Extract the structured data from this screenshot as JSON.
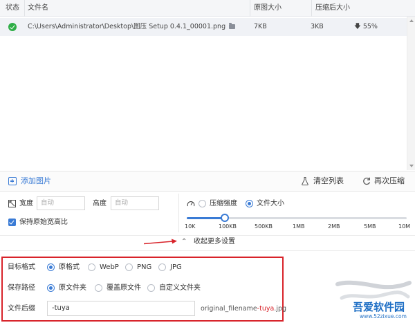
{
  "table": {
    "headers": {
      "status": "状态",
      "filename": "文件名",
      "original_size": "原图大小",
      "compressed_size": "压缩后大小"
    },
    "rows": [
      {
        "path": "C:\\Users\\Administrator\\Desktop\\图压 Setup 0.4.1_00001.png",
        "original": "7KB",
        "compressed": "3KB",
        "ratio": "55%"
      }
    ]
  },
  "toolbar": {
    "add_label": "添加图片",
    "clear_label": "清空列表",
    "recompress_label": "再次压缩"
  },
  "size": {
    "width_label": "宽度",
    "width_placeholder": "自动",
    "height_label": "高度",
    "height_placeholder": "自动",
    "keep_ratio_label": "保持原始宽高比"
  },
  "compress": {
    "strength_label": "压缩强度",
    "filesize_label": "文件大小",
    "ticks": [
      "10K",
      "100KB",
      "500KB",
      "1MB",
      "2MB",
      "5MB",
      "10M"
    ],
    "slider_value": "100KB"
  },
  "collapse_label": "收起更多设置",
  "settings": {
    "format_label": "目标格式",
    "formats": [
      "原格式",
      "WebP",
      "PNG",
      "JPG"
    ],
    "path_label": "保存路径",
    "paths": [
      "原文件夹",
      "覆盖原文件",
      "自定义文件夹"
    ],
    "suffix_label": "文件后缀",
    "suffix_value": "-tuya",
    "preview_prefix": "original_filename",
    "preview_suffix": "-tuya",
    "preview_ext": ".jpg"
  },
  "watermark": {
    "brand": "吾爱软件园",
    "url": "www.52zixue.com"
  },
  "colors": {
    "accent": "#3a7bd5",
    "success": "#2fae47",
    "highlight": "#d8232a"
  }
}
